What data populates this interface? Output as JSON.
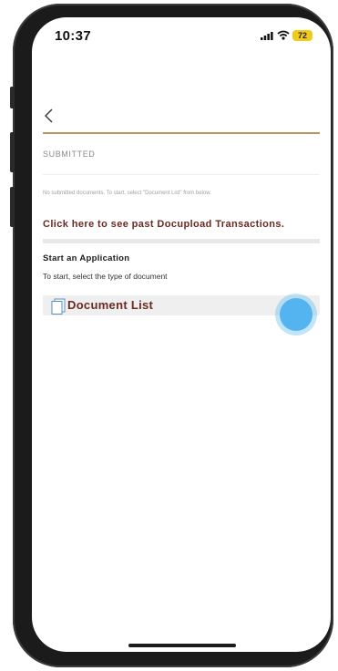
{
  "status_bar": {
    "time": "10:37",
    "battery": "72",
    "signal_icon": "signal-bars-icon",
    "wifi_icon": "wifi-icon",
    "battery_color": "#f2cb1a"
  },
  "nav": {
    "back_icon": "chevron-left-icon"
  },
  "submitted": {
    "section_label": "SUBMITTED",
    "empty_message": "No submitted documents. To start, select \"Document List\" from below.",
    "past_transactions_link": "Click here to see past Docupload Transactions."
  },
  "application": {
    "heading": "Start an Application",
    "instructions": "To start, select the type of document",
    "document_list_label": "Document List",
    "document_icon": "documents-icon"
  },
  "colors": {
    "accent_gold": "#b6965f",
    "link_maroon": "#6b2a22",
    "touch_indicator": "#53b4f0"
  }
}
